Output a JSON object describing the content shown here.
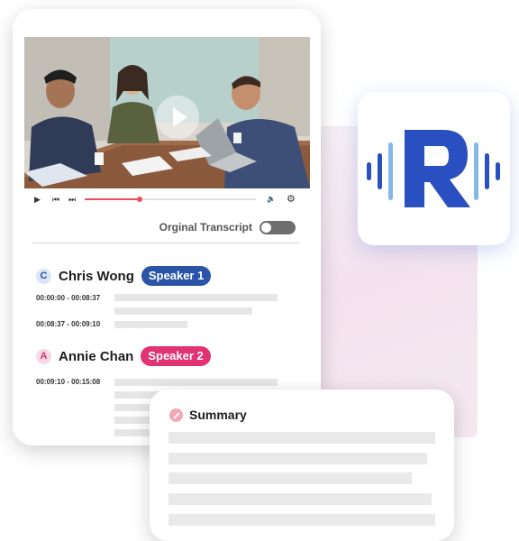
{
  "video": {
    "controls": {
      "play_icon": "play-icon",
      "prev_icon": "skip-back-icon",
      "next_icon": "skip-forward-icon",
      "volume_icon": "volume-icon",
      "settings_icon": "gear-icon",
      "progress": 0.32
    }
  },
  "transcript_toggle": {
    "label": "Orginal Transcript",
    "state": "off"
  },
  "speakers": [
    {
      "initial": "C",
      "name": "Chris Wong",
      "badge": "Speaker 1",
      "badge_color": "#2b54a8",
      "segments": [
        "00:00:00 - 00:08:37",
        "00:08:37 - 00:09:10"
      ]
    },
    {
      "initial": "A",
      "name": "Annie Chan",
      "badge": "Speaker 2",
      "badge_color": "#e03373",
      "segments": [
        "00:09:10 - 00:15:08"
      ]
    }
  ],
  "summary": {
    "title": "Summary",
    "icon": "magic-wand-icon"
  },
  "brand": {
    "logo_letter": "R",
    "logo_color": "#2a4fc0",
    "logo_icon": "sound-wave-r-logo"
  }
}
